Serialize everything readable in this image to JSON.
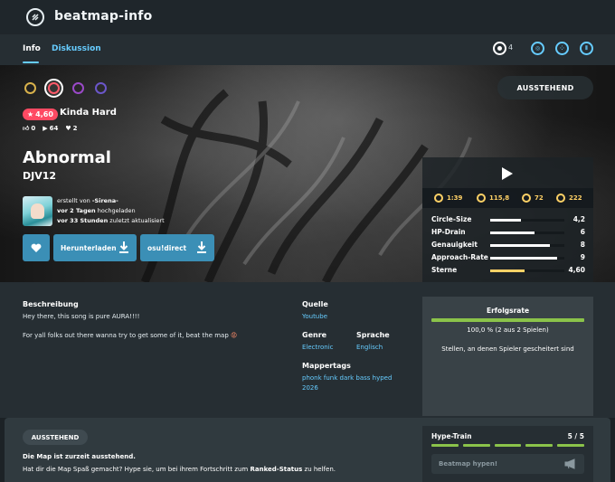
{
  "header": {
    "app_title": "beatmap-info"
  },
  "tabs": {
    "info": "Info",
    "discussion": "Diskussion"
  },
  "modes": {
    "standard_count": "4"
  },
  "difficulty": {
    "stars": "4,60",
    "name": "Kinda Hard"
  },
  "counts": {
    "plays_up": "0",
    "plays": "64",
    "favourites": "2"
  },
  "beatmap": {
    "title": "Abnormal",
    "artist": "DJV12"
  },
  "mapper": {
    "line1_prefix": "erstellt von",
    "name": "-Sirena-",
    "line2_bold": "vor 2 Tagen",
    "line2_rest": "hochgeladen",
    "line3_bold": "vor 33 Stunden",
    "line3_rest": "zuletzt aktualisiert"
  },
  "buttons": {
    "download": "Herunterladen",
    "osudirect": "osu!direct"
  },
  "status": "AUSSTEHEND",
  "metrics": {
    "length": "1:39",
    "bpm": "115,8",
    "circles": "72",
    "sliders": "222"
  },
  "attributes": [
    {
      "label": "Circle-Size",
      "value": "4,2",
      "fraction": 0.42
    },
    {
      "label": "HP-Drain",
      "value": "6",
      "fraction": 0.6
    },
    {
      "label": "Genauigkeit",
      "value": "8",
      "fraction": 0.8
    },
    {
      "label": "Approach-Rate",
      "value": "9",
      "fraction": 0.9
    },
    {
      "label": "Sterne",
      "value": "4,60",
      "fraction": 0.46
    }
  ],
  "description": {
    "heading": "Beschreibung",
    "line1": "Hey there, this song is pure AURA!!!!",
    "line2": "For yall folks out there wanna try to get some of it, beat the map"
  },
  "source": {
    "heading": "Quelle",
    "value": "Youtube"
  },
  "genre": {
    "heading": "Genre",
    "value": "Electronic"
  },
  "language": {
    "heading": "Sprache",
    "value": "Englisch"
  },
  "tags": {
    "heading": "Mappertags",
    "line1": "phonk funk dark bass hyped",
    "line2": "2026"
  },
  "success": {
    "heading": "Erfolgsrate",
    "percent_text": "100,0 % (2 aus 2 Spielen)",
    "fail_text": "Stellen, an denen Spieler gescheitert sind"
  },
  "pending": {
    "pill": "AUSSTEHEND",
    "line1": "Die Map ist zurzeit ausstehend.",
    "line2_a": "Hat dir die Map Spaß gemacht? Hype sie, um bei ihrem Fortschritt zum ",
    "line2_bold": "Ranked-Status",
    "line2_b": " zu helfen."
  },
  "hype": {
    "title": "Hype-Train",
    "count": "5 / 5",
    "button": "Beatmap hypen!"
  },
  "colors": {
    "accent": "#66ccff",
    "star_badge": "#ff4a63",
    "success": "#8bc34a",
    "metric": "#ffd166"
  }
}
